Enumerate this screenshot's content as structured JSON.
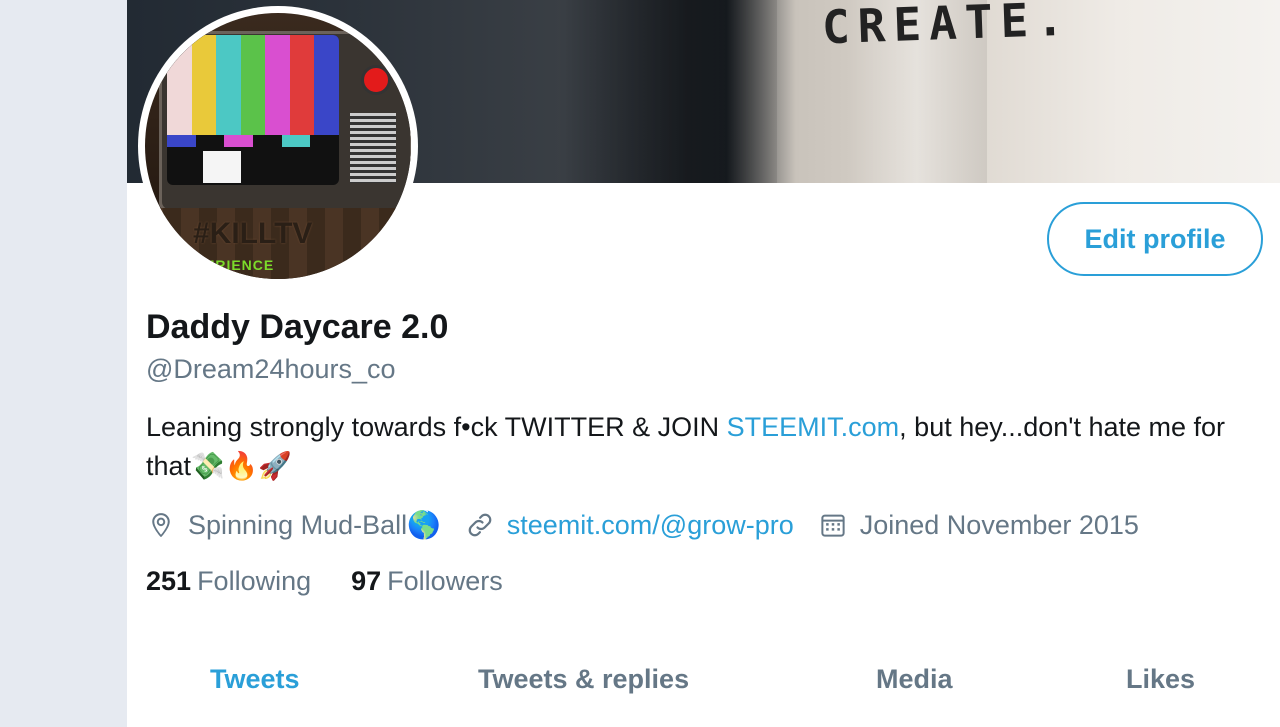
{
  "banner": {
    "text": "CREATE."
  },
  "avatar": {
    "logo_text": "#KILLTV",
    "logo_subtext": "ERIENCE"
  },
  "actions": {
    "edit_profile": "Edit profile"
  },
  "profile": {
    "display_name": "Daddy Daycare 2.0",
    "handle": "@Dream24hours_co",
    "bio_part1": "Leaning strongly towards f•ck TWITTER & JOIN ",
    "bio_link": "STEEMIT.com",
    "bio_part2": ", but hey...don't hate me for that💸🔥🚀",
    "location": "Spinning Mud-Ball🌎",
    "website": "steemit.com/@grow-pro",
    "joined": "Joined November 2015"
  },
  "stats": {
    "following_count": "251",
    "following_label": "Following",
    "followers_count": "97",
    "followers_label": "Followers"
  },
  "tabs": [
    {
      "label": "Tweets",
      "active": true
    },
    {
      "label": "Tweets & replies",
      "active": false
    },
    {
      "label": "Media",
      "active": false
    },
    {
      "label": "Likes",
      "active": false
    }
  ],
  "icons": {
    "location": "location-pin-icon",
    "website": "link-icon",
    "joined": "calendar-icon"
  },
  "colors": {
    "accent": "#2a9fd8",
    "secondary_text": "#657786",
    "primary_text": "#14171a"
  }
}
